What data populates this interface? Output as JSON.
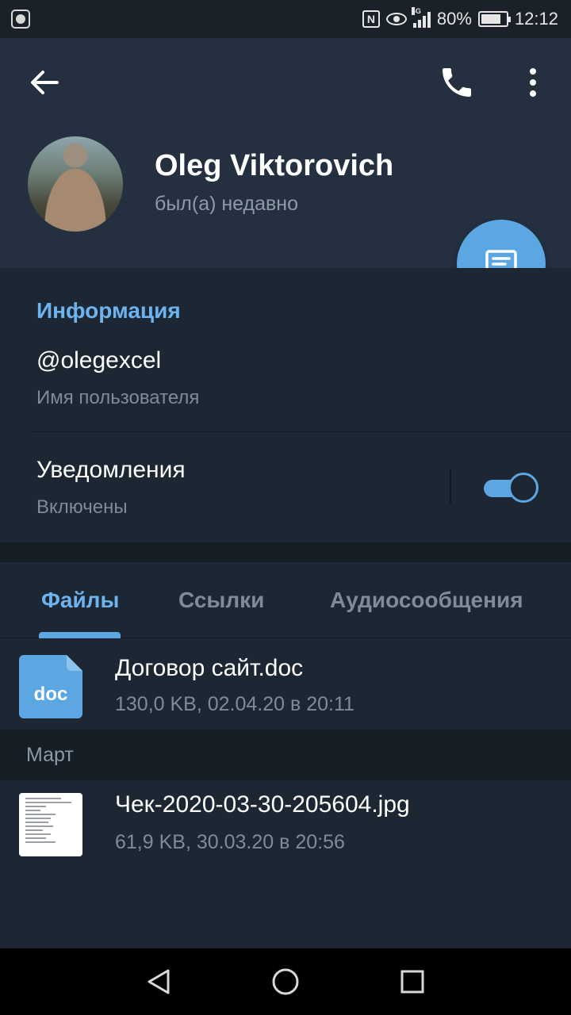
{
  "status_bar": {
    "battery": "80%",
    "time": "12:12",
    "network": "4G"
  },
  "profile": {
    "name": "Oleg Viktorovich",
    "status": "был(а) недавно"
  },
  "info": {
    "title": "Информация",
    "username": "@olegexcel",
    "username_label": "Имя пользователя",
    "notifications_title": "Уведомления",
    "notifications_value": "Включены",
    "notifications_enabled": true
  },
  "tabs": [
    {
      "label": "Файлы",
      "active": true
    },
    {
      "label": "Ссылки",
      "active": false
    },
    {
      "label": "Аудиосообщения",
      "active": false
    }
  ],
  "files": [
    {
      "name": "Договор сайт.doc",
      "meta": "130,0 KB, 02.04.20 в 20:11",
      "icon_label": "doc"
    },
    {
      "name": "Чек-2020-03-30-205604.jpg",
      "meta": "61,9 KB, 30.03.20 в 20:56"
    }
  ],
  "section": {
    "label": "Март"
  },
  "colors": {
    "accent": "#5ca7e2",
    "header_bg": "#243040",
    "body_bg": "#1d2733"
  }
}
